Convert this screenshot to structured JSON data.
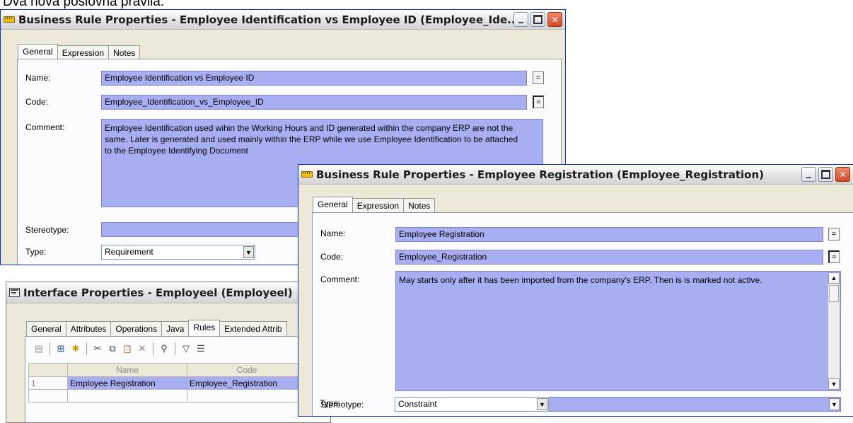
{
  "caption": "Dva nova poslovna pravila:",
  "window1": {
    "title": "Business Rule Properties - Employee Identification vs Employee ID (Employee_Ide...",
    "tabs": [
      "General",
      "Expression",
      "Notes"
    ],
    "labels": {
      "name": "Name:",
      "code": "Code:",
      "comment": "Comment:",
      "stereotype": "Stereotype:",
      "type": "Type:"
    },
    "name": "Employee Identification vs Employee ID",
    "code": "Employee_Identification_vs_Employee_ID",
    "comment": "Employee Identification used wihin the Working Hours and ID generated within the company ERP are not the same. Later is generated and used mainly within the ERP while we use Employee Identification to be attached to the Employee Identifying Document",
    "stereotype": "",
    "type": "Requirement"
  },
  "window2": {
    "title": "Business Rule Properties - Employee Registration (Employee_Registration)",
    "tabs": [
      "General",
      "Expression",
      "Notes"
    ],
    "labels": {
      "name": "Name:",
      "code": "Code:",
      "comment": "Comment:",
      "stereotype": "Stereotype:",
      "type": "Type:"
    },
    "name": "Employee Registration",
    "code": "Employee_Registration",
    "comment": "May starts only after it has been imported from the company's ERP. Then is is marked not active.",
    "stereotype": "",
    "type": "Constraint"
  },
  "window3": {
    "title": "Interface Properties - Employeel (Employeel)",
    "tabs": [
      "General",
      "Attributes",
      "Operations",
      "Java",
      "Rules",
      "Extended Attrib"
    ],
    "columns": [
      "",
      "Name",
      "Code"
    ],
    "rows": [
      {
        "index": "1",
        "name": "Employee Registration",
        "code": "Employee_Registration"
      }
    ]
  },
  "buttons": {
    "equals": "="
  },
  "icons": {
    "dropdown": "▼",
    "scroll_up": "▲",
    "scroll_down": "▼",
    "properties": "▤",
    "add_rows": "⊞",
    "new": "✱",
    "cut": "✂",
    "copy": "⧉",
    "paste": "📋",
    "delete": "✕",
    "find": "⚲",
    "filter": "▽",
    "customize": "☰"
  }
}
